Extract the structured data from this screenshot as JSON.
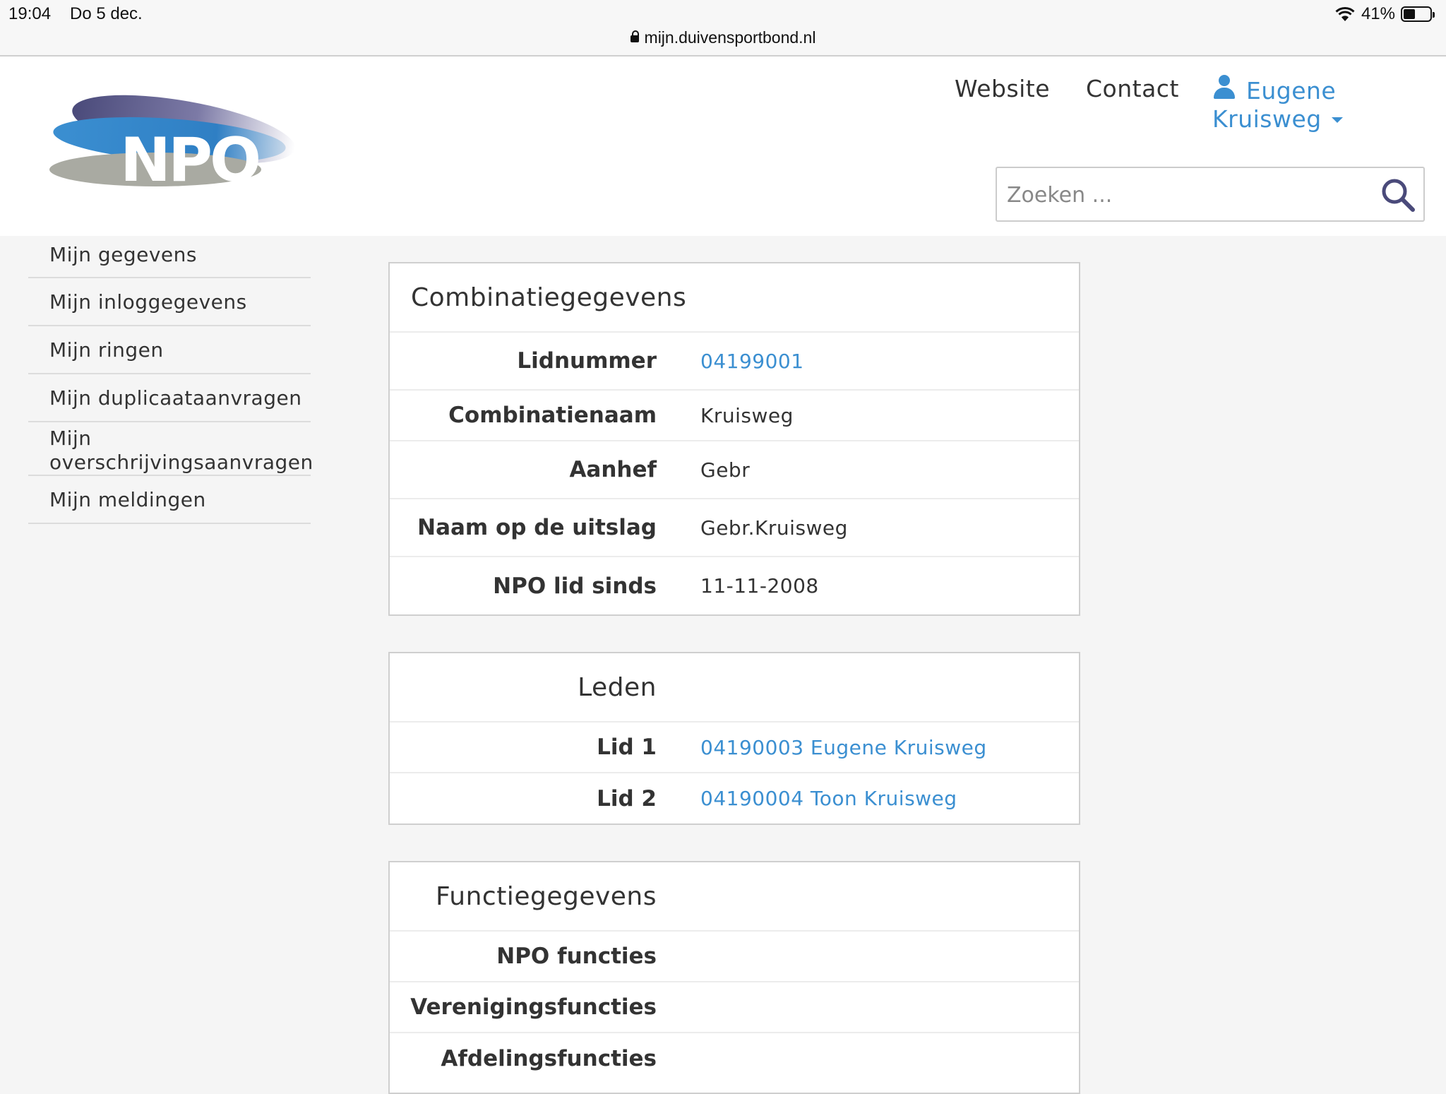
{
  "status_bar": {
    "time": "19:04",
    "date": "Do 5 dec.",
    "url": "mijn.duivensportbond.nl",
    "battery": "41%"
  },
  "header": {
    "logo_text": "NPO",
    "nav": {
      "website": "Website",
      "contact": "Contact"
    },
    "user": {
      "first": "Eugene",
      "last": "Kruisweg"
    },
    "search": {
      "placeholder": "Zoeken ..."
    }
  },
  "sidebar": {
    "items": [
      {
        "label": "Mijn gegevens"
      },
      {
        "label": "Mijn inloggegevens"
      },
      {
        "label": "Mijn ringen"
      },
      {
        "label": "Mijn duplicaataanvragen"
      },
      {
        "label_line1": "Mijn",
        "label_line2": "overschrijvingsaanvragen"
      },
      {
        "label": "Mijn meldingen"
      }
    ]
  },
  "combinatie": {
    "title": "Combinatiegegevens",
    "rows": [
      {
        "label": "Lidnummer",
        "value": "04199001"
      },
      {
        "label": "Combinatienaam",
        "value": "Kruisweg"
      },
      {
        "label": "Aanhef",
        "value": "Gebr"
      },
      {
        "label": "Naam op de uitslag",
        "value": "Gebr.Kruisweg"
      },
      {
        "label": "NPO lid sinds",
        "value": "11-11-2008"
      }
    ]
  },
  "leden": {
    "title": "Leden",
    "rows": [
      {
        "label": "Lid 1",
        "value": "04190003 Eugene Kruisweg"
      },
      {
        "label": "Lid 2",
        "value": "04190004 Toon Kruisweg"
      }
    ]
  },
  "functies": {
    "title": "Functiegegevens",
    "rows": [
      {
        "label": "NPO functies",
        "value": ""
      },
      {
        "label": "Verenigingsfuncties",
        "value": ""
      },
      {
        "label": "Afdelingsfuncties",
        "value": ""
      }
    ]
  },
  "colors": {
    "link": "#3b8fd1",
    "background": "#f5f5f5",
    "logo_dark": "#4a4a7a",
    "logo_blue": "#3b8fd1",
    "logo_gray": "#a9aaa2"
  }
}
